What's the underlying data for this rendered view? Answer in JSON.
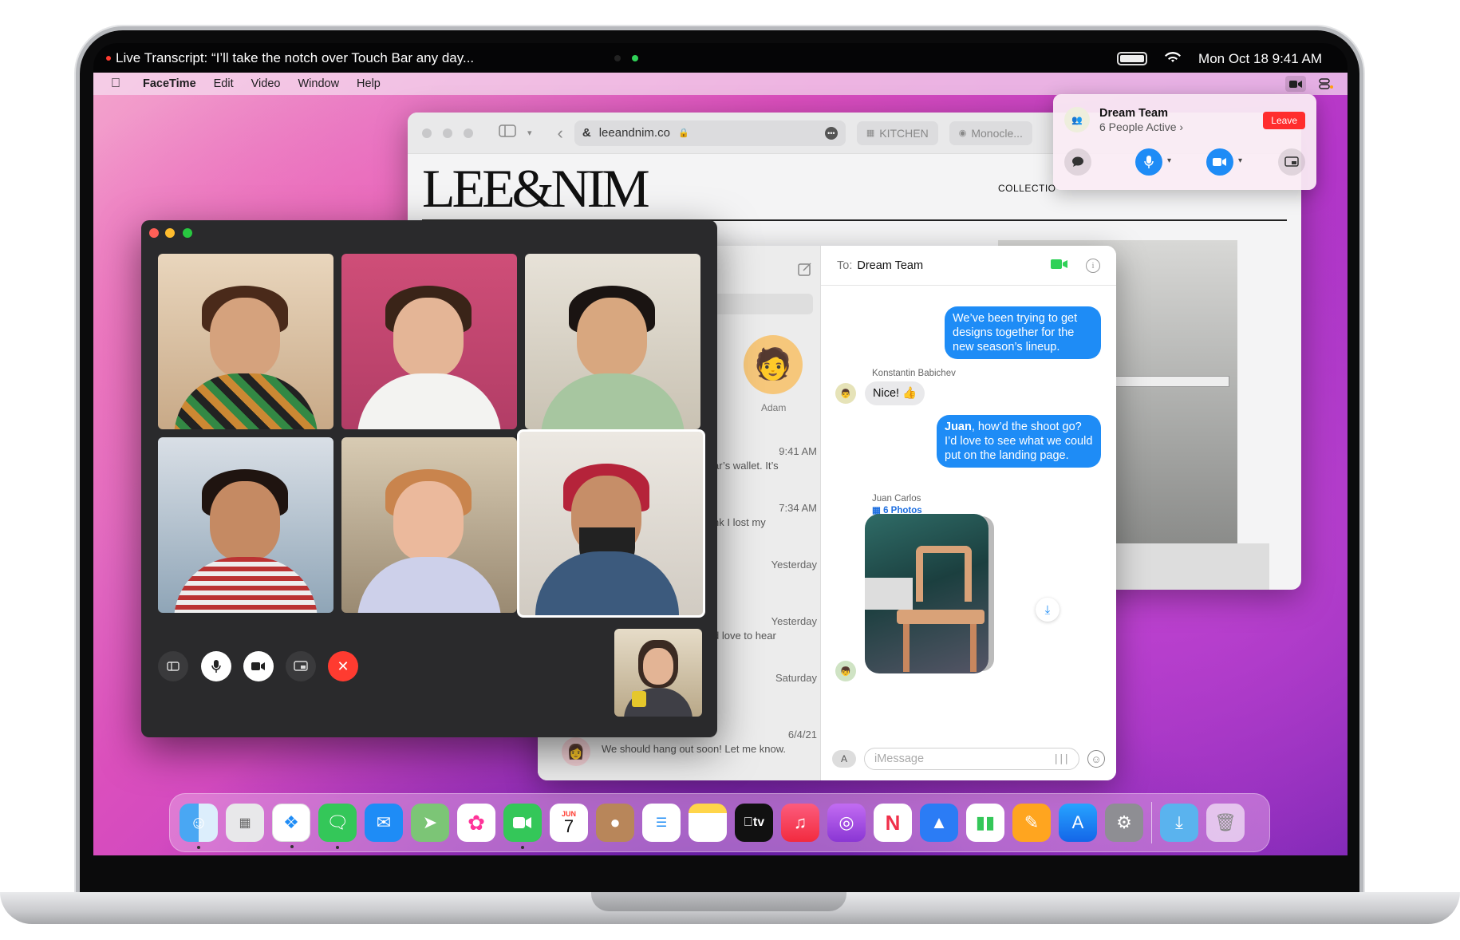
{
  "status_bar": {
    "transcript": "Live Transcript: “I’ll take the notch over Touch Bar any day...",
    "datetime": "Mon Oct 18 9:41 AM"
  },
  "menubar": {
    "app": "FaceTime",
    "items": [
      "Edit",
      "Video",
      "Window",
      "Help"
    ]
  },
  "safari": {
    "url": "leeandnim.co",
    "tabs": [
      "KITCHEN",
      "Monocle..."
    ],
    "site_title": "LEE&NIM",
    "nav_item": "COLLECTIO"
  },
  "shareplay": {
    "group_name": "Dream Team",
    "active": "6 People Active",
    "leave_label": "Leave"
  },
  "messages": {
    "to_label": "To:",
    "to_name": "Dream Team",
    "pinned_name": "Adam",
    "conversations": [
      {
        "time": "9:41 AM",
        "preview": "ar’s wallet. It’s"
      },
      {
        "time": "7:34 AM",
        "preview": "nk I lost my"
      },
      {
        "time": "Yesterday",
        "preview": ""
      },
      {
        "time": "Yesterday",
        "preview": "d love to hear"
      },
      {
        "time": "Saturday",
        "preview": ""
      },
      {
        "time": "6/4/21",
        "preview": "We should hang out soon! Let me know."
      }
    ],
    "bubble1": "We’ve been trying to get designs together for the new season’s lineup.",
    "sender2": "Konstantin Babichev",
    "bubble2": "Nice! 👍",
    "bubble3_bold": "Juan",
    "bubble3": ", how’d the shoot go? I’d love to see what we could put on the landing page.",
    "sender4": "Juan Carlos",
    "photos_label": "6 Photos",
    "input_placeholder": "iMessage"
  },
  "dock": {
    "apps": [
      "Finder",
      "Launchpad",
      "Safari",
      "Messages",
      "Mail",
      "Maps",
      "Photos",
      "FaceTime",
      "Calendar",
      "Contacts",
      "Reminders",
      "Notes",
      "TV",
      "Music",
      "Podcasts",
      "News",
      "Keynote",
      "Numbers",
      "Pages",
      "App Store",
      "System Preferences",
      "Downloads",
      "Trash"
    ],
    "calendar_month": "JUN",
    "calendar_day": "7",
    "tv_label": "tv"
  },
  "colors": {
    "accent_blue": "#1e8cf6",
    "leave_red": "#ff2d2d",
    "end_call_red": "#ff3b30",
    "camera_green": "#30d158"
  }
}
